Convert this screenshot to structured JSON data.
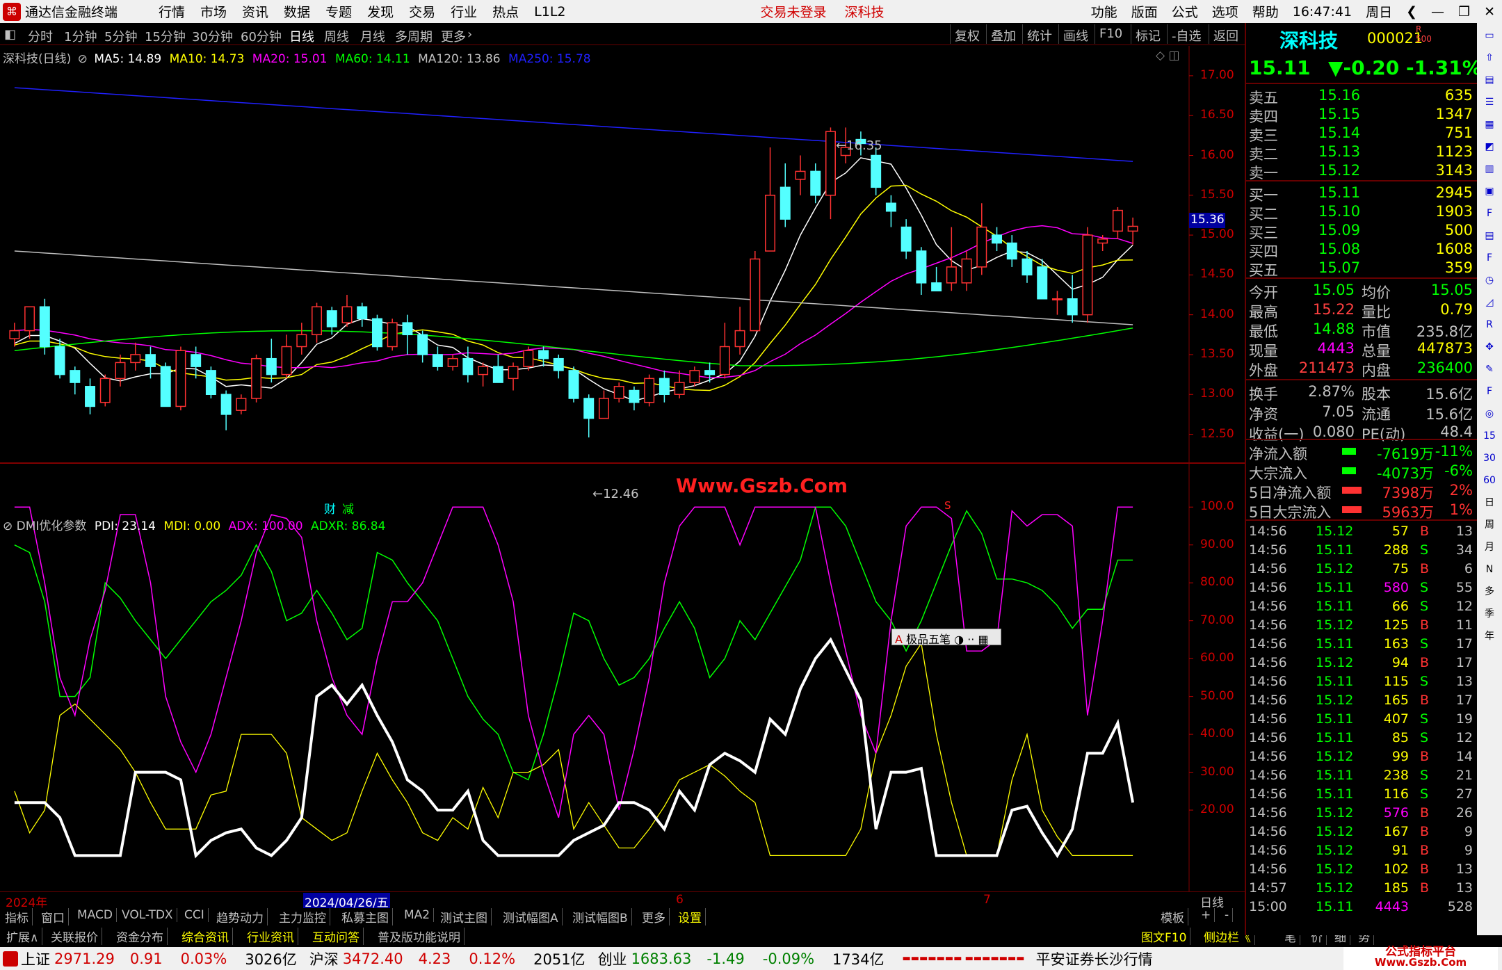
{
  "titlebar": {
    "app": "通达信金融终端",
    "menus": [
      "行情",
      "市场",
      "资讯",
      "数据",
      "专题",
      "发现",
      "交易",
      "行业",
      "热点",
      "L1L2"
    ],
    "login": "交易未登录",
    "stock": "深科技",
    "right": [
      "功能",
      "版面",
      "公式",
      "选项",
      "帮助"
    ],
    "time": "16:47:41",
    "weekday": "周日"
  },
  "toolbar": {
    "periods": [
      "分时",
      "1分钟",
      "5分钟",
      "15分钟",
      "30分钟",
      "60分钟",
      "日线",
      "周线",
      "月线",
      "多周期",
      "更多"
    ],
    "selected": "日线",
    "right": [
      "复权",
      "叠加",
      "统计",
      "画线",
      "F10",
      "标记",
      "-自选",
      "返回"
    ]
  },
  "main_legend": {
    "name": "深科技(日线)",
    "ma": [
      {
        "k": "MA5: 14.89",
        "c": "#ffffff"
      },
      {
        "k": "MA10: 14.73",
        "c": "#ffff00"
      },
      {
        "k": "MA20: 15.01",
        "c": "#ff00ff"
      },
      {
        "k": "MA60: 14.11",
        "c": "#00ff00"
      },
      {
        "k": "MA120: 13.86",
        "c": "#c0c0c0"
      },
      {
        "k": "MA250: 15.78",
        "c": "#2020ff"
      }
    ]
  },
  "price_axis": [
    "17.00",
    "16.50",
    "16.00",
    "15.50",
    "15.00",
    "14.50",
    "14.00",
    "13.50",
    "13.00",
    "12.50"
  ],
  "price_marker": "15.36",
  "annotations": {
    "high": "16.35",
    "low": "12.46",
    "watermark": "Www.Gszb.Com",
    "cai": "财",
    "jian": "减",
    "s": "S"
  },
  "dmi_legend": {
    "name": "DMI优化参数",
    "items": [
      {
        "k": "PDI: 23.14",
        "c": "#ffffff"
      },
      {
        "k": "MDI: 0.00",
        "c": "#ffff00"
      },
      {
        "k": "ADX: 100.00",
        "c": "#ff00ff"
      },
      {
        "k": "ADXR: 86.84",
        "c": "#00ff00"
      }
    ]
  },
  "dmi_axis": [
    "100.0",
    "90.00",
    "80.00",
    "70.00",
    "60.00",
    "50.00",
    "40.00",
    "30.00",
    "20.00"
  ],
  "ime": "极品五笔",
  "date_axis": {
    "left": "2024年",
    "mid": "2024/04/26/五",
    "m6": "6",
    "m7": "7",
    "right": "日线"
  },
  "bottom_tabs": [
    "指标",
    "窗口",
    "MACD",
    "VOL-TDX",
    "CCI",
    "趋势动力",
    "主力监控",
    "私募主图",
    "MA2",
    "测试主图",
    "测试幅图A",
    "测试幅图B",
    "更多",
    "设置"
  ],
  "bottom_right": [
    "模板",
    "+",
    "-"
  ],
  "bottom_tabs2": [
    "扩展∧",
    "关联报价",
    "资金分布",
    "综合资讯",
    "行业资讯",
    "互动问答",
    "普及版功能说明"
  ],
  "bottom_right2": [
    "图文F10",
    "侧边栏《",
    "笔",
    "价",
    "细",
    "势"
  ],
  "quote": {
    "name": "深科技",
    "code": "000021",
    "price": "15.11",
    "change": "▼-0.20",
    "pct": "-1.31%",
    "sell": [
      [
        "卖五",
        "15.16",
        "635"
      ],
      [
        "卖四",
        "15.15",
        "1347"
      ],
      [
        "卖三",
        "15.14",
        "751"
      ],
      [
        "卖二",
        "15.13",
        "1123"
      ],
      [
        "卖一",
        "15.12",
        "3143"
      ]
    ],
    "buy": [
      [
        "买一",
        "15.11",
        "2945"
      ],
      [
        "买二",
        "15.10",
        "1903"
      ],
      [
        "买三",
        "15.09",
        "500"
      ],
      [
        "买四",
        "15.08",
        "1608"
      ],
      [
        "买五",
        "15.07",
        "359"
      ]
    ],
    "stats": [
      [
        "今开",
        "15.05",
        "均价",
        "15.05"
      ],
      [
        "最高",
        "15.22",
        "量比",
        "0.79"
      ],
      [
        "最低",
        "14.88",
        "市值",
        "235.8亿"
      ],
      [
        "现量",
        "4443",
        "总量",
        "447873"
      ],
      [
        "外盘",
        "211473",
        "内盘",
        "236400"
      ]
    ],
    "stats2": [
      [
        "换手",
        "2.87%",
        "股本",
        "15.6亿"
      ],
      [
        "净资",
        "7.05",
        "流通",
        "15.6亿"
      ],
      [
        "收益(一)",
        "0.080",
        "PE(动)",
        "48.4"
      ]
    ],
    "flows": [
      [
        "净流入额",
        "-7619万",
        "-11%"
      ],
      [
        "大宗流入",
        "-4073万",
        "-6%"
      ],
      [
        "5日净流入额",
        "7398万",
        "2%"
      ],
      [
        "5日大宗流入",
        "5963万",
        "1%"
      ]
    ],
    "ticks": [
      [
        "14:56",
        "15.12",
        "57",
        "B",
        "13"
      ],
      [
        "14:56",
        "15.11",
        "288",
        "S",
        "34"
      ],
      [
        "14:56",
        "15.12",
        "75",
        "B",
        "6"
      ],
      [
        "14:56",
        "15.11",
        "580",
        "S",
        "55"
      ],
      [
        "14:56",
        "15.11",
        "66",
        "S",
        "12"
      ],
      [
        "14:56",
        "15.12",
        "125",
        "B",
        "11"
      ],
      [
        "14:56",
        "15.11",
        "163",
        "S",
        "17"
      ],
      [
        "14:56",
        "15.12",
        "94",
        "B",
        "17"
      ],
      [
        "14:56",
        "15.11",
        "115",
        "S",
        "13"
      ],
      [
        "14:56",
        "15.12",
        "165",
        "B",
        "17"
      ],
      [
        "14:56",
        "15.11",
        "407",
        "S",
        "19"
      ],
      [
        "14:56",
        "15.11",
        "85",
        "S",
        "12"
      ],
      [
        "14:56",
        "15.12",
        "99",
        "B",
        "14"
      ],
      [
        "14:56",
        "15.11",
        "238",
        "S",
        "21"
      ],
      [
        "14:56",
        "15.11",
        "116",
        "S",
        "27"
      ],
      [
        "14:56",
        "15.12",
        "576",
        "B",
        "26"
      ],
      [
        "14:56",
        "15.12",
        "167",
        "B",
        "9"
      ],
      [
        "14:56",
        "15.12",
        "91",
        "B",
        "9"
      ],
      [
        "14:56",
        "15.12",
        "102",
        "B",
        "13"
      ],
      [
        "14:57",
        "15.12",
        "185",
        "B",
        "13"
      ],
      [
        "15:00",
        "15.11",
        "4443",
        "",
        "528"
      ]
    ]
  },
  "status": {
    "indices": [
      [
        "上证",
        "2971.29",
        "0.91",
        "0.03%",
        "3026亿"
      ],
      [
        "沪深",
        "3472.40",
        "4.23",
        "0.12%",
        "2051亿"
      ],
      [
        "创业",
        "1683.63",
        "-1.49",
        "-0.09%",
        "1734亿"
      ]
    ],
    "bars": "▬▬▬▬▬▬▬ ▬▬▬▬▬▬▬",
    "broker": "平安证券长沙行情",
    "logo": "公式指标平台",
    "logo_url": "Www.Gszb.Com"
  },
  "sidebar_labels": [
    "日",
    "周",
    "月",
    "N",
    "多",
    "季",
    "年"
  ],
  "chart_data": {
    "type": "candlestick",
    "candles": [
      [
        13.7,
        13.8,
        13.9,
        13.6
      ],
      [
        13.8,
        14.1,
        14.1,
        13.7
      ],
      [
        14.1,
        13.6,
        14.2,
        13.5
      ],
      [
        13.6,
        13.25,
        13.7,
        13.2
      ],
      [
        13.3,
        13.15,
        13.35,
        13.0
      ],
      [
        13.1,
        12.85,
        13.2,
        12.75
      ],
      [
        12.9,
        13.2,
        13.25,
        12.85
      ],
      [
        13.2,
        13.4,
        13.5,
        13.1
      ],
      [
        13.4,
        13.5,
        13.65,
        13.3
      ],
      [
        13.5,
        13.35,
        13.6,
        13.2
      ],
      [
        13.35,
        12.85,
        13.4,
        12.85
      ],
      [
        12.85,
        13.55,
        13.6,
        12.8
      ],
      [
        13.5,
        13.35,
        13.6,
        13.2
      ],
      [
        13.3,
        13.0,
        13.35,
        12.95
      ],
      [
        13.0,
        12.75,
        13.05,
        12.55
      ],
      [
        12.8,
        12.95,
        13.0,
        12.75
      ],
      [
        12.95,
        13.45,
        13.5,
        12.9
      ],
      [
        13.45,
        13.25,
        13.7,
        13.15
      ],
      [
        13.25,
        13.6,
        13.75,
        13.2
      ],
      [
        13.6,
        13.75,
        13.9,
        13.5
      ],
      [
        13.75,
        14.1,
        14.15,
        13.65
      ],
      [
        14.05,
        13.85,
        14.1,
        13.75
      ],
      [
        13.9,
        14.1,
        14.25,
        13.85
      ],
      [
        14.1,
        13.95,
        14.15,
        13.85
      ],
      [
        13.95,
        13.6,
        14.0,
        13.55
      ],
      [
        13.6,
        13.9,
        13.95,
        13.55
      ],
      [
        13.9,
        13.75,
        14.0,
        13.5
      ],
      [
        13.75,
        13.5,
        13.8,
        13.4
      ],
      [
        13.5,
        13.35,
        13.6,
        13.3
      ],
      [
        13.35,
        13.45,
        13.5,
        13.3
      ],
      [
        13.45,
        13.25,
        13.6,
        13.15
      ],
      [
        13.25,
        13.35,
        13.4,
        13.1
      ],
      [
        13.35,
        13.15,
        13.5,
        13.15
      ],
      [
        13.2,
        13.35,
        13.4,
        13.05
      ],
      [
        13.35,
        13.55,
        13.6,
        13.3
      ],
      [
        13.55,
        13.45,
        13.6,
        13.35
      ],
      [
        13.45,
        13.3,
        13.5,
        13.2
      ],
      [
        13.3,
        12.95,
        13.35,
        12.9
      ],
      [
        12.95,
        12.7,
        13.0,
        12.46
      ],
      [
        12.7,
        12.95,
        13.05,
        12.7
      ],
      [
        12.95,
        13.1,
        13.15,
        12.9
      ],
      [
        13.05,
        12.9,
        13.1,
        12.8
      ],
      [
        12.9,
        13.2,
        13.25,
        12.85
      ],
      [
        13.2,
        13.0,
        13.3,
        12.9
      ],
      [
        13.0,
        13.15,
        13.3,
        12.95
      ],
      [
        13.15,
        13.3,
        13.35,
        13.1
      ],
      [
        13.3,
        13.25,
        13.4,
        13.15
      ],
      [
        13.25,
        13.6,
        13.9,
        13.2
      ],
      [
        13.6,
        13.8,
        14.1,
        13.5
      ],
      [
        13.8,
        14.7,
        14.8,
        13.8
      ],
      [
        14.8,
        15.5,
        16.1,
        14.8
      ],
      [
        15.6,
        15.2,
        15.9,
        15.1
      ],
      [
        15.7,
        15.8,
        16.0,
        15.5
      ],
      [
        15.8,
        15.5,
        15.9,
        15.4
      ],
      [
        15.5,
        16.3,
        16.35,
        15.2
      ],
      [
        16.0,
        16.1,
        16.35,
        15.9
      ],
      [
        16.2,
        16.15,
        16.3,
        16.0
      ],
      [
        16.0,
        15.6,
        16.1,
        15.5
      ],
      [
        15.4,
        15.3,
        15.5,
        15.1
      ],
      [
        15.1,
        14.8,
        15.2,
        14.7
      ],
      [
        14.8,
        14.4,
        14.85,
        14.25
      ],
      [
        14.4,
        14.3,
        14.6,
        14.3
      ],
      [
        14.4,
        14.6,
        15.1,
        14.3
      ],
      [
        14.4,
        14.7,
        14.8,
        14.3
      ],
      [
        14.6,
        15.1,
        15.4,
        14.5
      ],
      [
        15.0,
        14.9,
        15.1,
        14.8
      ],
      [
        14.9,
        14.7,
        15.0,
        14.6
      ],
      [
        14.7,
        14.5,
        14.8,
        14.4
      ],
      [
        14.6,
        14.2,
        14.7,
        14.2
      ],
      [
        14.2,
        14.2,
        14.3,
        14.0
      ],
      [
        14.2,
        14.0,
        14.5,
        13.9
      ],
      [
        14.0,
        15.0,
        15.1,
        13.9
      ],
      [
        14.9,
        14.95,
        15.0,
        14.8
      ],
      [
        15.05,
        15.31,
        15.35,
        14.95
      ],
      [
        15.05,
        15.11,
        15.22,
        14.88
      ]
    ],
    "ma_series": [
      {
        "name": "MA5",
        "color": "#ffffff"
      },
      {
        "name": "MA10",
        "color": "#ffff00"
      },
      {
        "name": "MA20",
        "color": "#ff00ff"
      },
      {
        "name": "MA60",
        "color": "#00ff00"
      },
      {
        "name": "MA120",
        "color": "#c0c0c0"
      },
      {
        "name": "MA250",
        "color": "#2020ff"
      }
    ],
    "ylim": [
      12.4,
      17.2
    ],
    "dmi": {
      "ylim": [
        0,
        105
      ],
      "PDI": [
        22,
        22,
        22,
        18,
        8,
        8,
        8,
        8,
        30,
        30,
        30,
        28,
        8,
        12,
        14,
        15,
        10,
        8,
        12,
        18,
        50,
        53,
        48,
        53,
        45,
        38,
        28,
        25,
        20,
        20,
        25,
        12,
        8,
        8,
        8,
        8,
        8,
        12,
        14,
        16,
        22,
        22,
        20,
        15,
        25,
        20,
        32,
        35,
        33,
        30,
        44,
        40,
        52,
        60,
        65,
        57,
        49,
        15,
        30,
        30,
        31,
        8,
        8,
        8,
        8,
        8,
        20,
        21,
        14,
        8,
        15,
        35,
        35,
        43,
        22
      ],
      "MDI": [
        25,
        14,
        20,
        45,
        48,
        44,
        40,
        36,
        30,
        22,
        15,
        15,
        15,
        24,
        25,
        40,
        40,
        40,
        35,
        18,
        15,
        12,
        14,
        25,
        35,
        28,
        22,
        14,
        12,
        18,
        15,
        26,
        18,
        30,
        30,
        32,
        36,
        15,
        22,
        16,
        10,
        10,
        15,
        21,
        28,
        30,
        32,
        29,
        25,
        22,
        8,
        8,
        8,
        8,
        8,
        8,
        15,
        35,
        45,
        58,
        64,
        40,
        22,
        8,
        8,
        8,
        28,
        40,
        20,
        13,
        8,
        8,
        8,
        8,
        8
      ],
      "ADX": [
        100,
        100,
        80,
        55,
        45,
        65,
        78,
        98,
        98,
        80,
        50,
        38,
        30,
        40,
        55,
        70,
        88,
        98,
        97,
        92,
        70,
        55,
        45,
        40,
        60,
        75,
        75,
        80,
        90,
        100,
        100,
        100,
        90,
        75,
        45,
        30,
        18,
        40,
        45,
        40,
        20,
        36,
        55,
        80,
        95,
        100,
        100,
        100,
        90,
        100,
        100,
        100,
        100,
        100,
        80,
        62,
        45,
        35,
        70,
        95,
        100,
        100,
        97,
        62,
        62,
        65,
        99,
        95,
        98,
        98,
        95,
        45,
        70,
        100,
        100
      ],
      "ADXR": [
        90,
        88,
        75,
        50,
        50,
        55,
        80,
        76,
        70,
        65,
        60,
        65,
        70,
        75,
        78,
        82,
        90,
        83,
        70,
        72,
        78,
        72,
        65,
        68,
        88,
        86,
        80,
        75,
        70,
        60,
        50,
        44,
        40,
        30,
        28,
        40,
        55,
        72,
        70,
        60,
        53,
        55,
        60,
        68,
        75,
        68,
        55,
        60,
        70,
        65,
        72,
        79,
        86,
        100,
        100,
        95,
        85,
        75,
        70,
        62,
        70,
        80,
        90,
        99,
        93,
        81,
        81,
        80,
        78,
        74,
        68,
        73,
        73,
        86,
        86
      ]
    }
  }
}
